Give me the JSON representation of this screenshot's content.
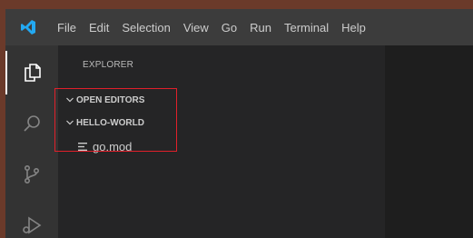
{
  "menu": [
    "File",
    "Edit",
    "Selection",
    "View",
    "Go",
    "Run",
    "Terminal",
    "Help"
  ],
  "sidebar": {
    "title": "EXPLORER",
    "open_editors": "OPEN EDITORS",
    "folder": "HELLO-WORLD",
    "files": [
      "go.mod"
    ]
  },
  "icons": {
    "app": "vscode-logo-icon",
    "activity": [
      "files-icon",
      "search-icon",
      "source-control-icon",
      "run-debug-icon"
    ],
    "file": "file-lines-icon"
  },
  "colors": {
    "accent": "#23a9f2",
    "titlebar": "#3c3c3c",
    "activitybar": "#333333",
    "sidebar": "#252526",
    "editor": "#1e1e1e",
    "highlight": "#e0202a"
  }
}
